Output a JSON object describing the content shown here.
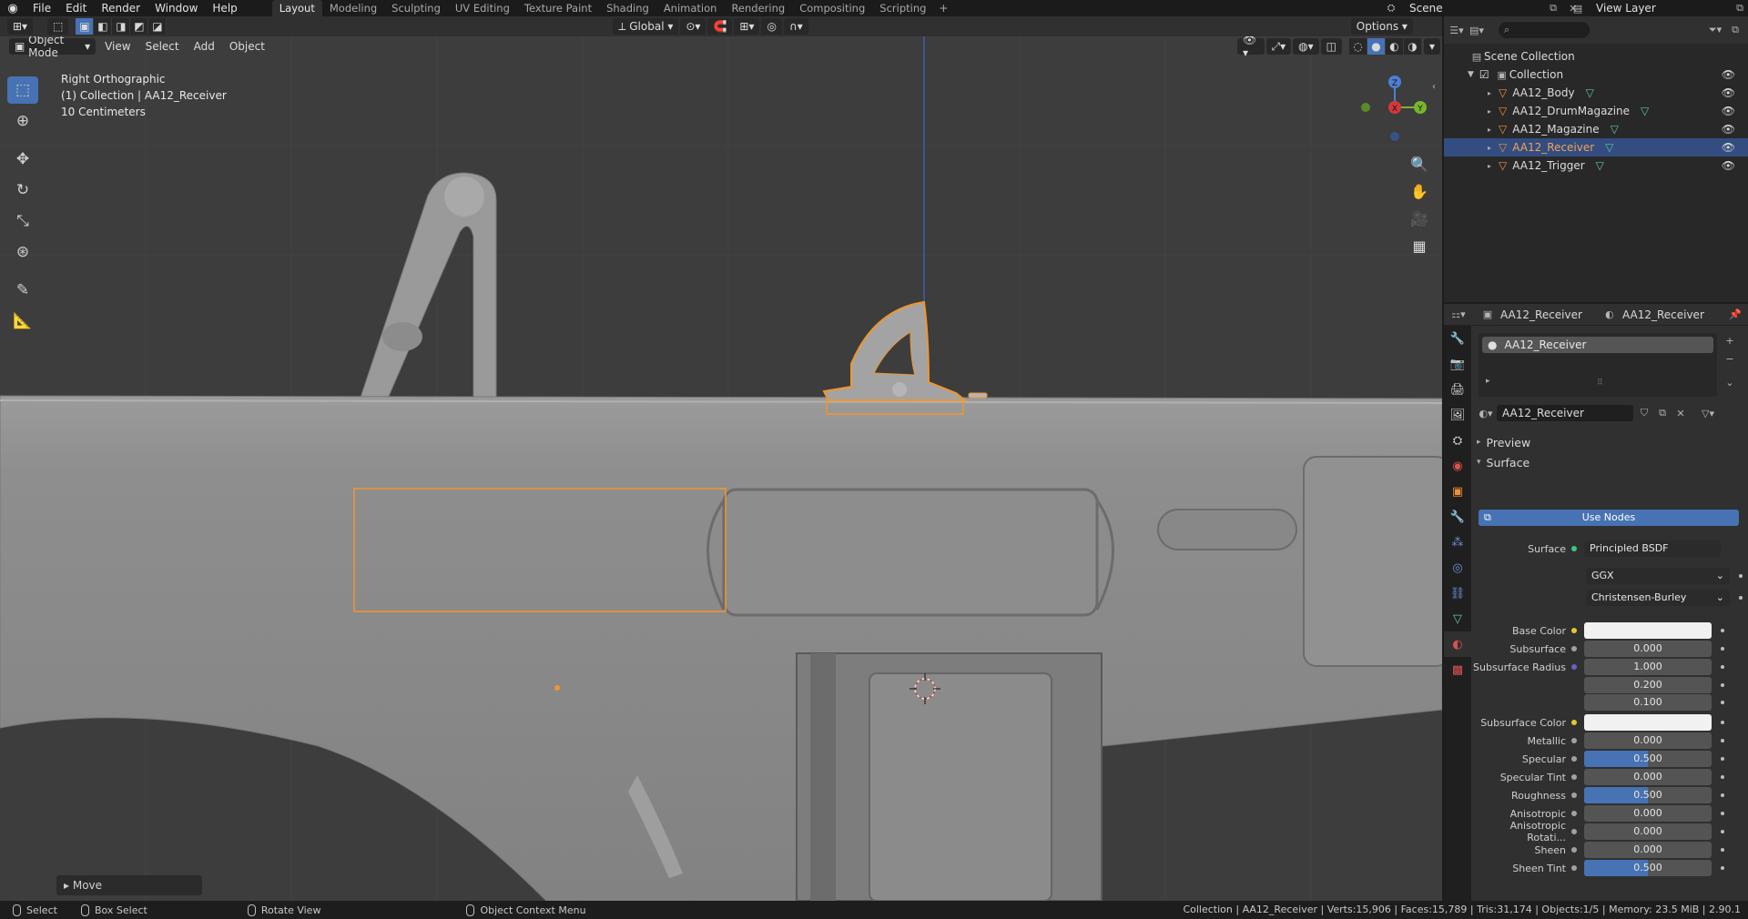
{
  "menu": {
    "items": [
      "File",
      "Edit",
      "Render",
      "Window",
      "Help"
    ]
  },
  "workspaces": {
    "tabs": [
      "Layout",
      "Modeling",
      "Sculpting",
      "UV Editing",
      "Texture Paint",
      "Shading",
      "Animation",
      "Rendering",
      "Compositing",
      "Scripting"
    ],
    "active": "Layout",
    "add_label": "+"
  },
  "scene": {
    "name": "Scene",
    "view_layer": "View Layer"
  },
  "viewport_header": {
    "mode": "Object Mode",
    "menus": [
      "View",
      "Select",
      "Add",
      "Object"
    ],
    "orientation": "Global",
    "options_label": "Options"
  },
  "viewport_info": {
    "view_name": "Right Orthographic",
    "collection_line": "(1) Collection | AA12_Receiver",
    "scale": "10 Centimeters"
  },
  "gizmo": {
    "z": "Z",
    "x": "X",
    "y": "Y"
  },
  "last_operator": "Move",
  "outliner": {
    "root": "Scene Collection",
    "collection": "Collection",
    "objects": [
      {
        "name": "AA12_Body",
        "selected": false
      },
      {
        "name": "AA12_DrumMagazine",
        "selected": false
      },
      {
        "name": "AA12_Magazine",
        "selected": false
      },
      {
        "name": "AA12_Receiver",
        "selected": true
      },
      {
        "name": "AA12_Trigger",
        "selected": false
      }
    ]
  },
  "properties": {
    "header_object": "AA12_Receiver",
    "header_material": "AA12_Receiver",
    "slot": "AA12_Receiver",
    "material_name": "AA12_Receiver",
    "preview_label": "Preview",
    "surface_label": "Surface",
    "use_nodes_label": "Use Nodes",
    "surface_row": {
      "label": "Surface",
      "value": "Principled BSDF"
    },
    "distribution": "GGX",
    "subsurface_method": "Christensen-Burley",
    "rows": [
      {
        "label": "Base Color",
        "value": "",
        "kind": "color",
        "dot": "#e3c53a"
      },
      {
        "label": "Subsurface",
        "value": "0.000",
        "fill": 0,
        "dot": "#a1a1a1"
      },
      {
        "label": "Subsurface Radius",
        "value": "1.000",
        "fill": 0,
        "dot": "#6363c7"
      },
      {
        "label": "",
        "value": "0.200",
        "fill": 0,
        "dot": ""
      },
      {
        "label": "",
        "value": "0.100",
        "fill": 0,
        "dot": ""
      },
      {
        "label": "Subsurface Color",
        "value": "",
        "kind": "color",
        "dot": "#e3c53a"
      },
      {
        "label": "Metallic",
        "value": "0.000",
        "fill": 0,
        "dot": "#a1a1a1"
      },
      {
        "label": "Specular",
        "value": "0.500",
        "fill": 0.5,
        "dot": "#a1a1a1"
      },
      {
        "label": "Specular Tint",
        "value": "0.000",
        "fill": 0,
        "dot": "#a1a1a1"
      },
      {
        "label": "Roughness",
        "value": "0.500",
        "fill": 0.5,
        "dot": "#a1a1a1"
      },
      {
        "label": "Anisotropic",
        "value": "0.000",
        "fill": 0,
        "dot": "#a1a1a1"
      },
      {
        "label": "Anisotropic Rotati...",
        "value": "0.000",
        "fill": 0,
        "dot": "#a1a1a1"
      },
      {
        "label": "Sheen",
        "value": "0.000",
        "fill": 0,
        "dot": "#a1a1a1"
      },
      {
        "label": "Sheen Tint",
        "value": "0.500",
        "fill": 0.5,
        "dot": "#a1a1a1"
      }
    ]
  },
  "statusbar": {
    "select": "Select",
    "box_select": "Box Select",
    "rotate_view": "Rotate View",
    "context_menu": "Object Context Menu",
    "stats": "Collection | AA12_Receiver | Verts:15,906 | Faces:15,789 | Tris:31,174 | Objects:1/5 | Memory: 23.5 MiB | 2.90.1"
  },
  "colors": {
    "accent": "#4772b3",
    "selection_outline": "#f0962e",
    "selected_row": "#334d80",
    "viewport_bg": "#3d3d3d"
  }
}
